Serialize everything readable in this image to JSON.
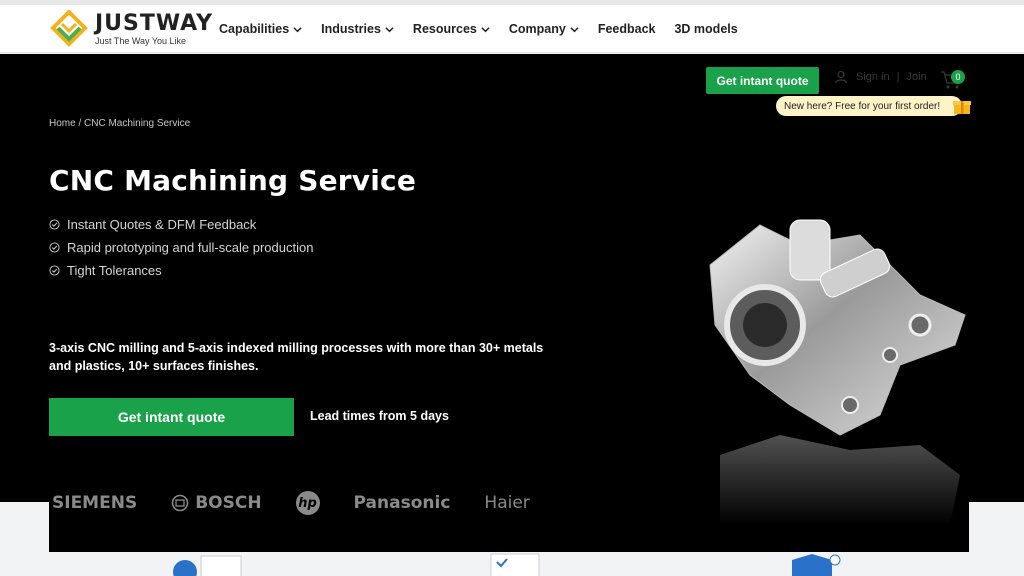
{
  "brand": {
    "name": "JUSTWAY",
    "slogan": "Just The Way You Like"
  },
  "nav": {
    "items": [
      {
        "label": "Capabilities",
        "dropdown": true
      },
      {
        "label": "Industries",
        "dropdown": true
      },
      {
        "label": "Resources",
        "dropdown": true
      },
      {
        "label": "Company",
        "dropdown": true
      },
      {
        "label": "Feedback",
        "dropdown": false
      },
      {
        "label": "3D models",
        "dropdown": false
      }
    ]
  },
  "header": {
    "quote_label": "Get intant quote",
    "sign_in": "Sign in",
    "divider": "|",
    "join": "Join",
    "cart_count": "0",
    "promo": "New here? Free for your first order!"
  },
  "hero": {
    "breadcrumb": "Home / CNC Machining Service",
    "title": "CNC Machining Service",
    "features": [
      "Instant Quotes & DFM Feedback",
      "Rapid prototyping and full-scale production",
      "Tight Tolerances"
    ],
    "description": "3-axis CNC milling and 5-axis indexed milling processes with more than 30+ metals and plastics, 10+ surfaces finishes.",
    "cta_label": "Get intant quote",
    "lead_time": "Lead times from 5 days"
  },
  "brands": [
    "SIEMENS",
    "BOSCH",
    "hp",
    "Panasonic",
    "Haier"
  ],
  "colors": {
    "accent": "#19a24a",
    "hero_bg": "#000000",
    "promo_bg": "#fff3c8"
  }
}
